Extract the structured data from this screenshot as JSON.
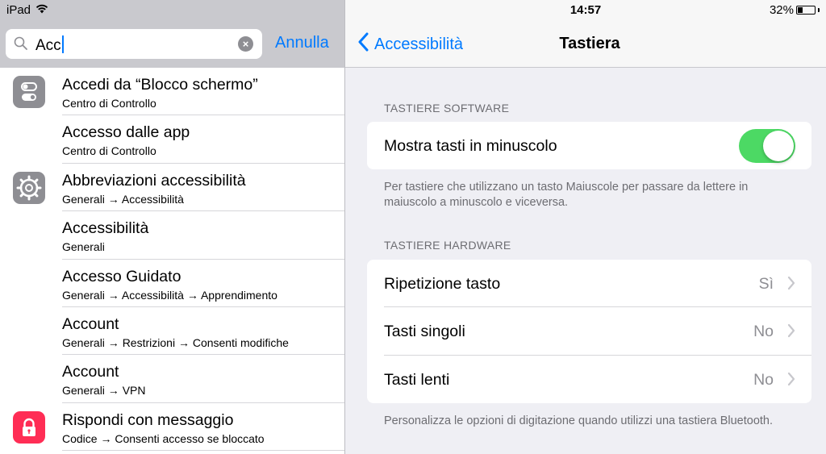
{
  "status": {
    "device": "iPad",
    "time": "14:57",
    "battery": "32%",
    "battery_level": 0.32
  },
  "search": {
    "query": "Acc",
    "cancel_label": "Annulla"
  },
  "results": [
    {
      "title": "Accedi da “Blocco schermo”",
      "subtitle": "Centro di Controllo",
      "icon": "control-center-icon"
    },
    {
      "title": "Accesso dalle app",
      "subtitle": "Centro di Controllo",
      "icon": ""
    },
    {
      "title": "Abbreviazioni accessibilità",
      "subtitle": "Generali → Accessibilità",
      "icon": "settings-gear-icon"
    },
    {
      "title": "Accessibilità",
      "subtitle": "Generali",
      "icon": ""
    },
    {
      "title": "Accesso Guidato",
      "subtitle": "Generali → Accessibilità → Apprendimento",
      "icon": ""
    },
    {
      "title": "Account",
      "subtitle": "Generali → Restrizioni → Consenti modifiche",
      "icon": ""
    },
    {
      "title": "Account",
      "subtitle": "Generali → VPN",
      "icon": ""
    },
    {
      "title": "Rispondi con messaggio",
      "subtitle": "Codice → Consenti accesso se bloccato",
      "icon": "passcode-lock-icon"
    }
  ],
  "nav": {
    "back_label": "Accessibilità",
    "title": "Tastiera"
  },
  "software_section": {
    "header": "TASTIERE SOFTWARE",
    "toggle_label": "Mostra tasti in minuscolo",
    "toggle_on": true,
    "footer": "Per tastiere che utilizzano un tasto Maiuscole per passare da lettere in maiuscolo a minuscolo e viceversa."
  },
  "hardware_section": {
    "header": "TASTIERE HARDWARE",
    "cells": [
      {
        "label": "Ripetizione tasto",
        "value": "Sì"
      },
      {
        "label": "Tasti singoli",
        "value": "No"
      },
      {
        "label": "Tasti lenti",
        "value": "No"
      }
    ],
    "footer": "Personalizza le opzioni di digitazione quando utilizzi una tastiera Bluetooth."
  },
  "colors": {
    "accent": "#007aff",
    "toggle_on": "#4cd964",
    "passcode_icon": "#ff2d55",
    "settings_icon": "#8e8e93"
  }
}
